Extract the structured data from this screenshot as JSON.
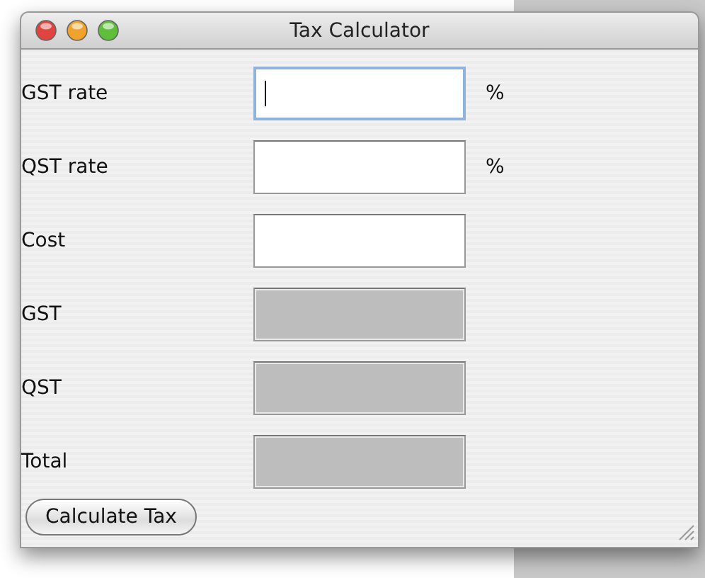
{
  "window": {
    "title": "Tax Calculator"
  },
  "rows": [
    {
      "label": "GST rate",
      "kind": "entry",
      "focused": true,
      "unit": "%"
    },
    {
      "label": "QST rate",
      "kind": "entry",
      "focused": false,
      "unit": "%"
    },
    {
      "label": "Cost",
      "kind": "entry",
      "focused": false
    },
    {
      "label": "GST",
      "kind": "result",
      "focused": false
    },
    {
      "label": "QST",
      "kind": "result",
      "focused": false
    },
    {
      "label": "Total",
      "kind": "result",
      "focused": false
    }
  ],
  "button": "Calculate Tax"
}
